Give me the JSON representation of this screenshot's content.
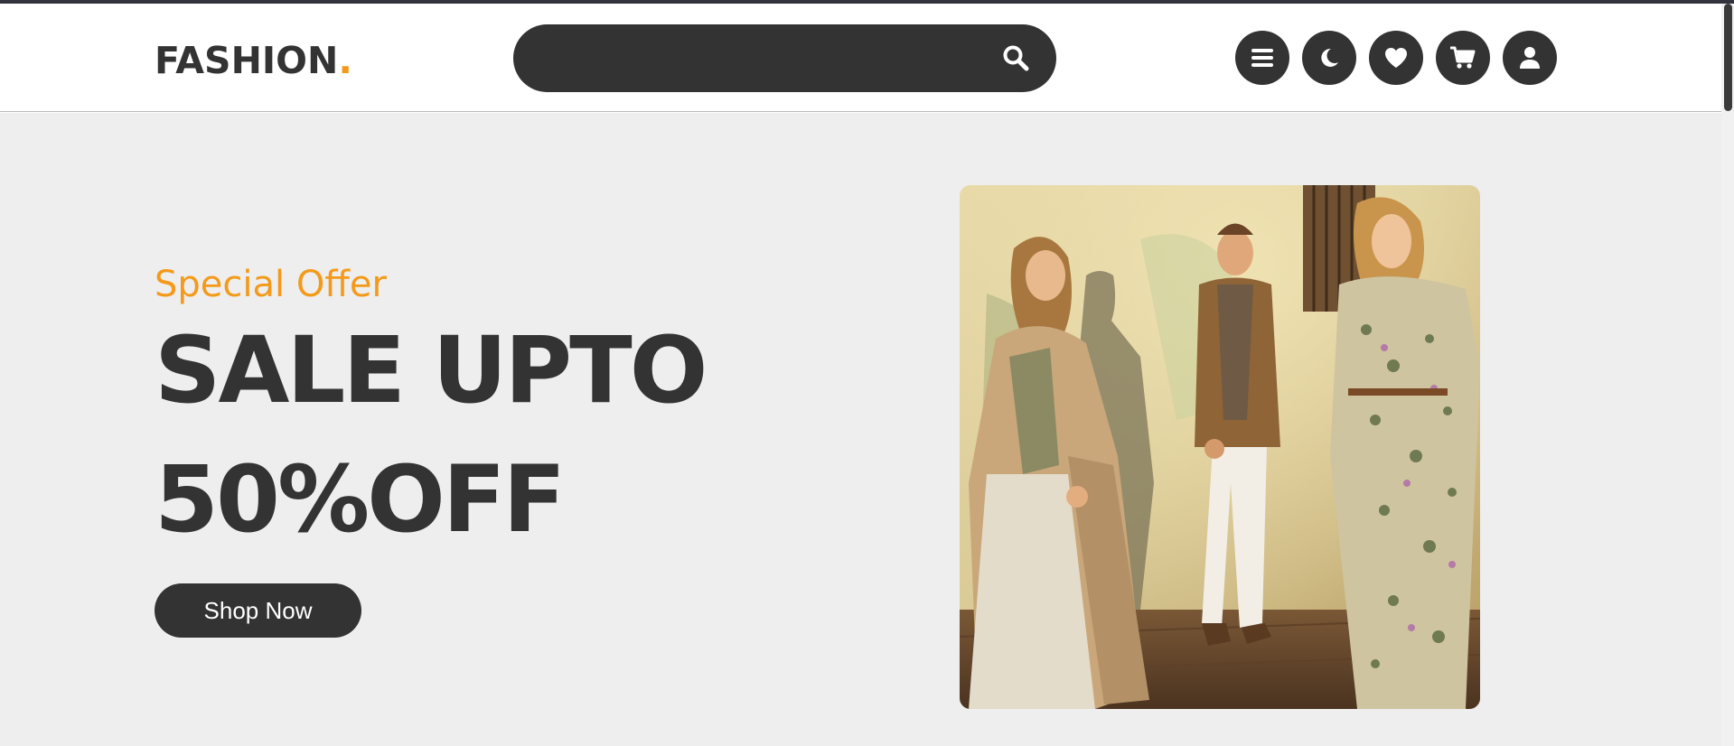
{
  "header": {
    "logo_text": "FASHION",
    "logo_dot": ".",
    "search": {
      "value": "",
      "placeholder": ""
    },
    "icons": [
      "menu-icon",
      "moon-icon",
      "heart-icon",
      "cart-icon",
      "user-icon"
    ]
  },
  "hero": {
    "eyebrow": "Special Offer",
    "headline_line1": "SALE UPTO",
    "headline_line2": "50%OFF",
    "cta_label": "Shop Now",
    "image_alt": "Three models in fashion outfits"
  },
  "colors": {
    "accent": "#f49a1a",
    "dark": "#333333",
    "hero_bg": "#eeeeee"
  }
}
